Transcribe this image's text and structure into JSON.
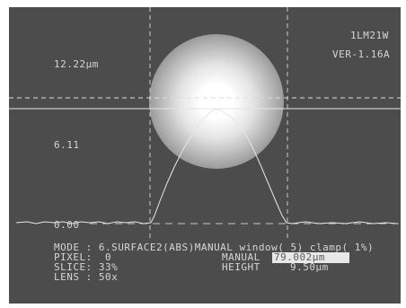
{
  "header": {
    "model": "1LM21W",
    "version": "VER-1.16A"
  },
  "scale": {
    "top_label": "12.22μm",
    "mid_label": "6.11",
    "zero_label": "0.00"
  },
  "status": {
    "mode": "MODE : 6.SURFACE2(ABS)MANUAL window( 5) clamp( 1%)",
    "pixel": "PIXEL:  0",
    "slice": "SLICE: 33%",
    "lens": "LENS : 50x",
    "manual_label": "MANUAL",
    "manual_value": "79.002μm",
    "height_label": "HEIGHT",
    "height_value": "9.50μm"
  },
  "colors": {
    "screen_bg": "#4b4c4b",
    "trace": "#e6e6e6",
    "cursor": "#c8c8c8"
  }
}
